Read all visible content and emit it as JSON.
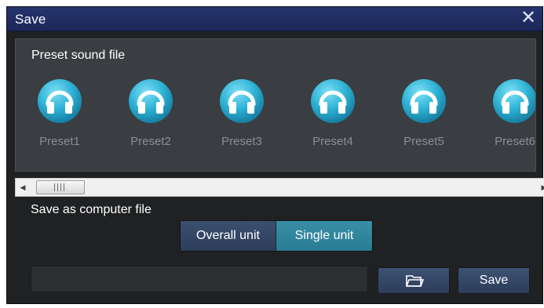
{
  "window": {
    "title": "Save",
    "close_icon": "close-icon"
  },
  "preset_section": {
    "label": "Preset sound file",
    "icon": "headphones-icon",
    "items": [
      {
        "label": "Preset1"
      },
      {
        "label": "Preset2"
      },
      {
        "label": "Preset3"
      },
      {
        "label": "Preset4"
      },
      {
        "label": "Preset5"
      },
      {
        "label": "Preset6"
      }
    ]
  },
  "scrollbar": {
    "left_icon": "arrow-left-icon",
    "right_icon": "arrow-right-icon",
    "grip_icon": "grip-icon"
  },
  "computer_section": {
    "label": "Save as computer file",
    "toggle": {
      "options": [
        "Overall unit",
        "Single unit"
      ],
      "selected": "Single unit"
    },
    "path_field": {
      "value": "",
      "placeholder": ""
    },
    "browse_icon": "folder-icon",
    "save_label": "Save"
  },
  "colors": {
    "titlebar": "#26346e",
    "icon_accent": "#2fb3d6",
    "toggle_selected": "#3a8fa6",
    "button": "#3d5272"
  }
}
